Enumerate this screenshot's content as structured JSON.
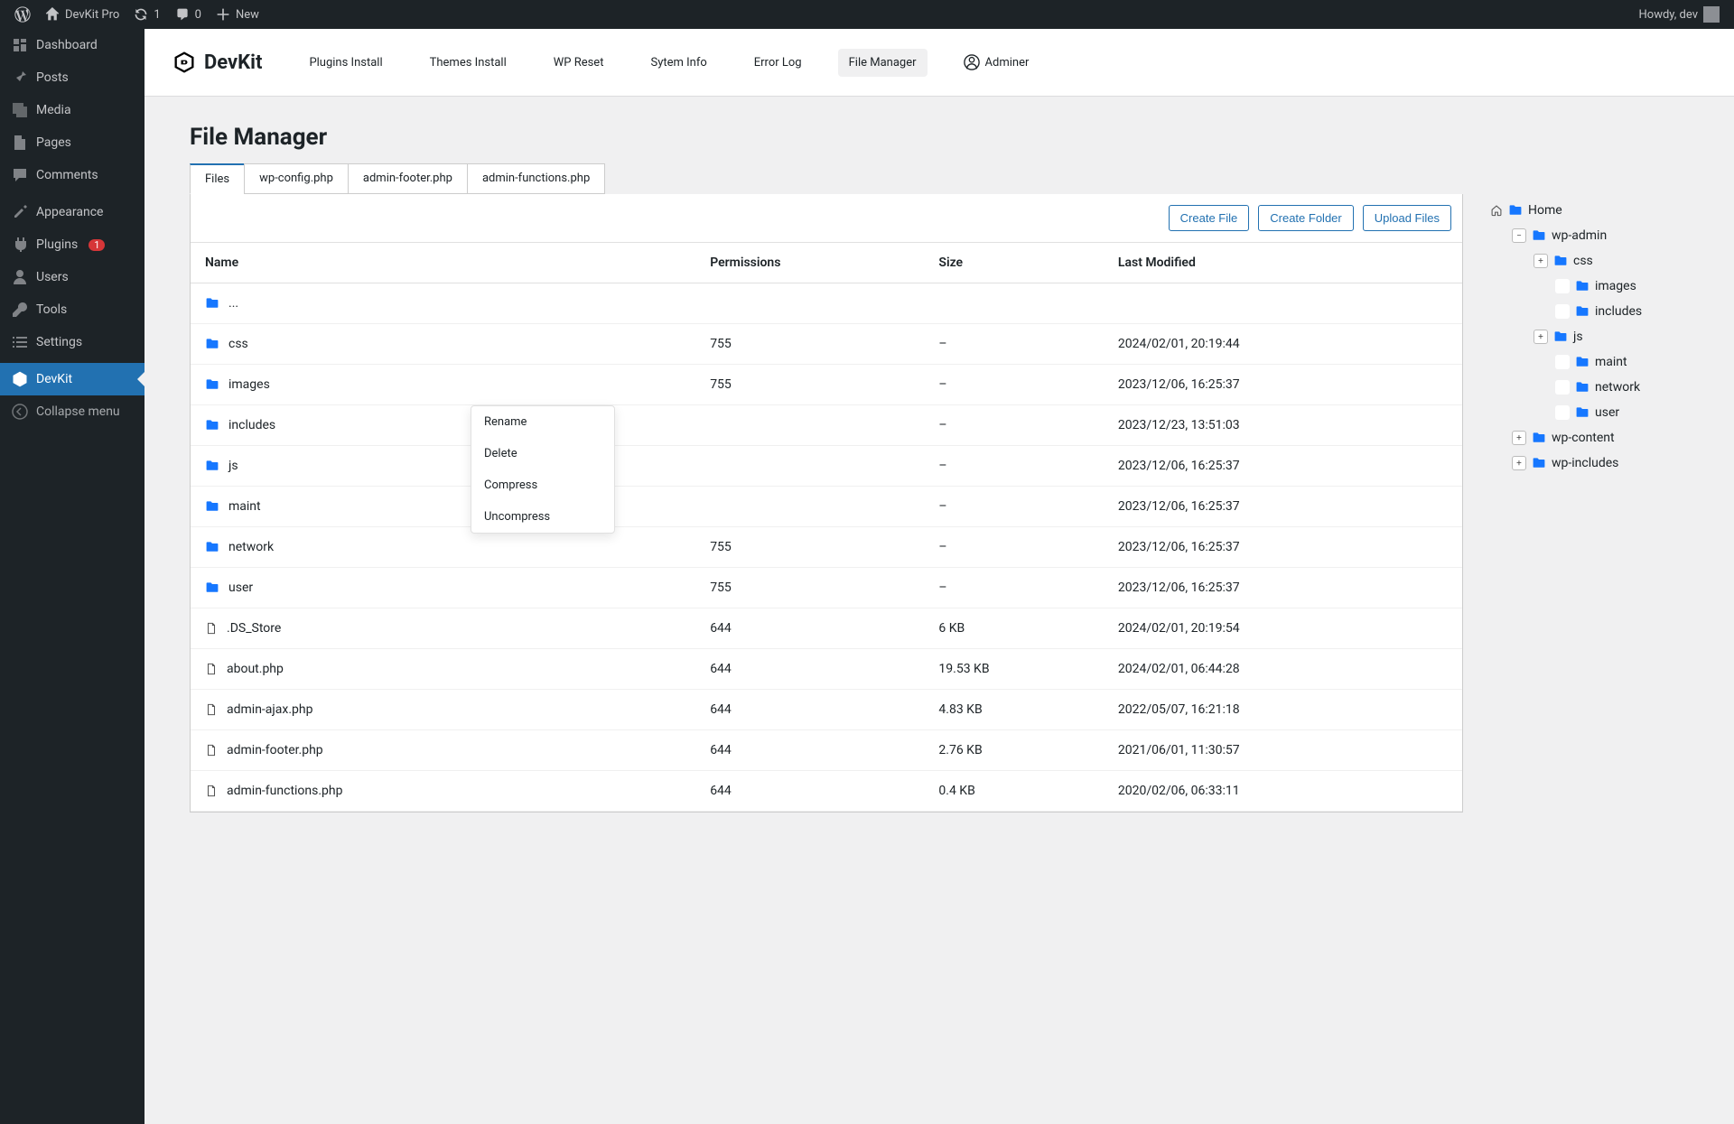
{
  "admin_bar": {
    "site_name": "DevKit Pro",
    "updates": "1",
    "comments": "0",
    "new": "New",
    "howdy": "Howdy, dev"
  },
  "sidebar": {
    "items": [
      {
        "label": "Dashboard",
        "icon": "dashboard"
      },
      {
        "label": "Posts",
        "icon": "pin"
      },
      {
        "label": "Media",
        "icon": "media"
      },
      {
        "label": "Pages",
        "icon": "pages"
      },
      {
        "label": "Comments",
        "icon": "comments"
      },
      {
        "label": "Appearance",
        "icon": "appearance"
      },
      {
        "label": "Plugins",
        "icon": "plugins",
        "badge": "1"
      },
      {
        "label": "Users",
        "icon": "users"
      },
      {
        "label": "Tools",
        "icon": "tools"
      },
      {
        "label": "Settings",
        "icon": "settings"
      },
      {
        "label": "DevKit",
        "icon": "devkit",
        "current": true
      },
      {
        "label": "Collapse menu",
        "icon": "collapse",
        "collapse": true
      }
    ]
  },
  "plugin_header": {
    "logo": "DevKit",
    "nav": [
      {
        "label": "Plugins Install"
      },
      {
        "label": "Themes Install"
      },
      {
        "label": "WP Reset"
      },
      {
        "label": "Sytem Info"
      },
      {
        "label": "Error Log"
      },
      {
        "label": "File Manager",
        "active": true
      },
      {
        "label": "Adminer",
        "icon": "user"
      }
    ]
  },
  "page_title": "File Manager",
  "tabs": [
    {
      "label": "Files",
      "active": true
    },
    {
      "label": "wp-config.php"
    },
    {
      "label": "admin-footer.php"
    },
    {
      "label": "admin-functions.php"
    }
  ],
  "toolbar": {
    "create_file": "Create File",
    "create_folder": "Create Folder",
    "upload_files": "Upload Files"
  },
  "columns": {
    "name": "Name",
    "permissions": "Permissions",
    "size": "Size",
    "modified": "Last Modified"
  },
  "rows": [
    {
      "type": "folder",
      "name": "...",
      "perm": "",
      "size": "",
      "modified": ""
    },
    {
      "type": "folder",
      "name": "css",
      "perm": "755",
      "size": "–",
      "modified": "2024/02/01, 20:19:44"
    },
    {
      "type": "folder",
      "name": "images",
      "perm": "755",
      "size": "–",
      "modified": "2023/12/06, 16:25:37"
    },
    {
      "type": "folder",
      "name": "includes",
      "perm": "",
      "size": "–",
      "modified": "2023/12/23, 13:51:03"
    },
    {
      "type": "folder",
      "name": "js",
      "perm": "",
      "size": "–",
      "modified": "2023/12/06, 16:25:37"
    },
    {
      "type": "folder",
      "name": "maint",
      "perm": "",
      "size": "–",
      "modified": "2023/12/06, 16:25:37"
    },
    {
      "type": "folder",
      "name": "network",
      "perm": "755",
      "size": "–",
      "modified": "2023/12/06, 16:25:37"
    },
    {
      "type": "folder",
      "name": "user",
      "perm": "755",
      "size": "–",
      "modified": "2023/12/06, 16:25:37"
    },
    {
      "type": "file",
      "name": ".DS_Store",
      "perm": "644",
      "size": "6 KB",
      "modified": "2024/02/01, 20:19:54"
    },
    {
      "type": "file",
      "name": "about.php",
      "perm": "644",
      "size": "19.53 KB",
      "modified": "2024/02/01, 06:44:28"
    },
    {
      "type": "file",
      "name": "admin-ajax.php",
      "perm": "644",
      "size": "4.83 KB",
      "modified": "2022/05/07, 16:21:18"
    },
    {
      "type": "file",
      "name": "admin-footer.php",
      "perm": "644",
      "size": "2.76 KB",
      "modified": "2021/06/01, 11:30:57"
    },
    {
      "type": "file",
      "name": "admin-functions.php",
      "perm": "644",
      "size": "0.4 KB",
      "modified": "2020/02/06, 06:33:11"
    }
  ],
  "context_menu": {
    "rename": "Rename",
    "delete": "Delete",
    "compress": "Compress",
    "uncompress": "Uncompress"
  },
  "tree": {
    "home": "Home",
    "wp_admin": "wp-admin",
    "css": "css",
    "images": "images",
    "includes": "includes",
    "js": "js",
    "maint": "maint",
    "network": "network",
    "user": "user",
    "wp_content": "wp-content",
    "wp_includes": "wp-includes"
  }
}
